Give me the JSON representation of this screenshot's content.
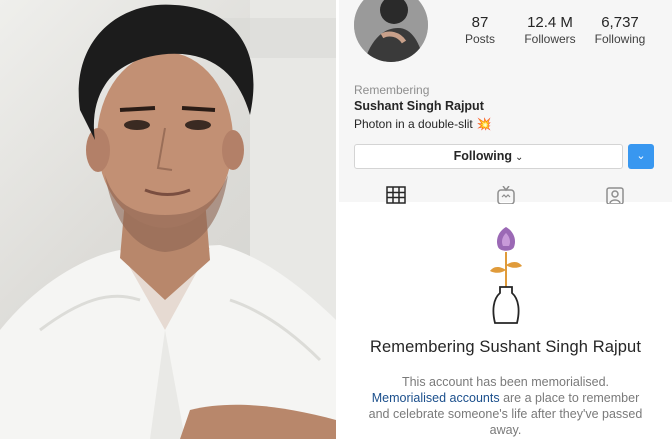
{
  "profile": {
    "stats": [
      {
        "value": "87",
        "label": "Posts"
      },
      {
        "value": "12.4 M",
        "label": "Followers"
      },
      {
        "value": "6,737",
        "label": "Following"
      }
    ],
    "remembering_label": "Remembering",
    "name": "Sushant Singh Rajput",
    "bio": "Photon in a double-slit",
    "bio_emoji": "💥",
    "following_button": "Following",
    "following_caret": "⌄",
    "dropdown_glyph": "⌄"
  },
  "tabs": [
    {
      "icon": "grid-icon"
    },
    {
      "icon": "igtv-icon"
    },
    {
      "icon": "tagged-icon"
    }
  ],
  "memorial": {
    "title": "Remembering Sushant Singh Rajput",
    "line1": "This account has been memorialised.",
    "link_text": "Memorialised accounts",
    "line2_rest": " are a place to remember",
    "line3": "and celebrate someone's life after they've passed",
    "line4": "away.",
    "icon": "memorial-flower-vase-icon"
  },
  "colors": {
    "accent": "#3897f0",
    "link": "#1b4f8c",
    "flower": "#8a4fa8",
    "stem": "#e09b3a"
  }
}
